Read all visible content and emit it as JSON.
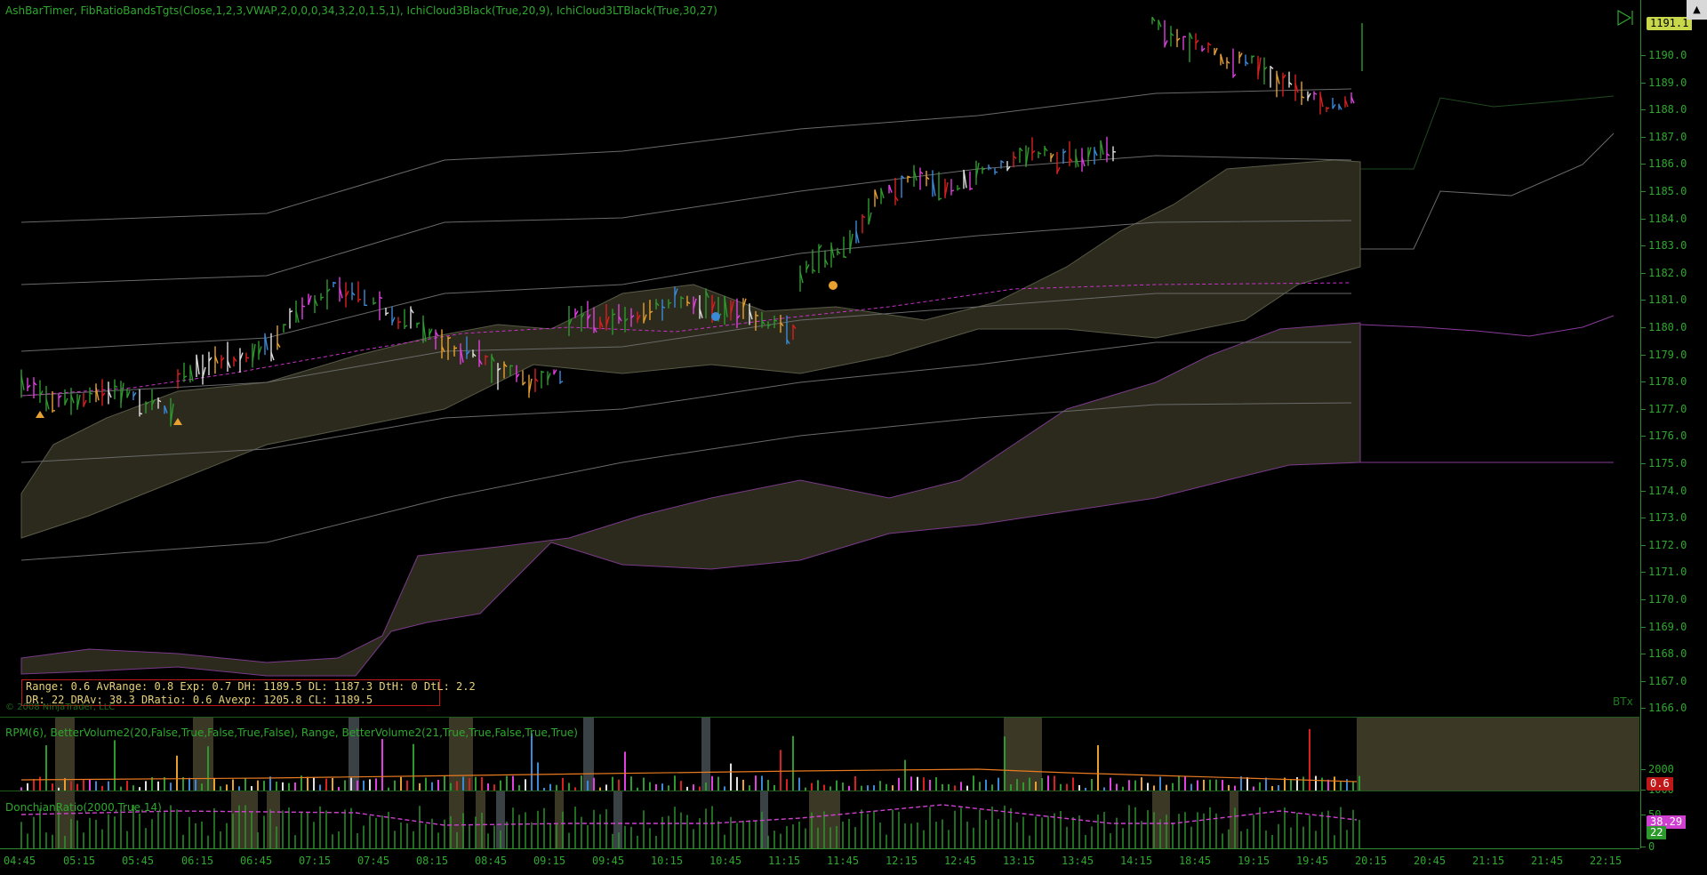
{
  "main_pane": {
    "indicators": "AshBarTimer,  FibRatioBandsTgts(Close,1,2,3,VWAP,2,0,0,0,34,3,2,0,1.5,1),  IchiCloud3Black(True,20,9),  IchiCloud3LTBlack(True,30,27)",
    "info_line1": "Range: 0.6  AvRange: 0.8  Exp: 0.7  DH: 1189.5  DL: 1187.3  DtH: 0  DtL: 2.2",
    "info_line2": "DR: 22 DRAv: 38.3 DRatio: 0.6 Avexp: 1205.8 CL: 1189.5",
    "copyright": "© 2008 NinjaTrader, LLC",
    "corner_label": "BTx",
    "last_price": "1191.1",
    "price_ticks": [
      "1190.0",
      "1189.0",
      "1188.0",
      "1187.0",
      "1186.0",
      "1185.0",
      "1184.0",
      "1183.0",
      "1182.0",
      "1181.0",
      "1180.0",
      "1179.0",
      "1178.0",
      "1177.0",
      "1176.0",
      "1175.0",
      "1174.0",
      "1173.0",
      "1172.0",
      "1171.0",
      "1170.0",
      "1169.0",
      "1168.0",
      "1167.0",
      "1166.0"
    ]
  },
  "rpm_pane": {
    "indicators": "RPM(6),  BetterVolume2(20,False,True,False,True,False),  Range,  BetterVolume2(21,True,True,False,True,True)",
    "ticks": [
      "2000",
      "1000"
    ],
    "badge": "0.6"
  },
  "donchian_pane": {
    "indicators": "DonchianRatio(2000,True,14)",
    "badge1": "38.29",
    "badge2": "22",
    "ticks": [
      "50",
      "0"
    ]
  },
  "time_axis": [
    "04:45",
    "05:15",
    "05:45",
    "06:15",
    "06:45",
    "07:15",
    "07:45",
    "08:15",
    "08:45",
    "09:15",
    "09:45",
    "10:15",
    "10:45",
    "11:15",
    "11:45",
    "12:15",
    "12:45",
    "13:15",
    "13:45",
    "14:15",
    "18:45",
    "19:15",
    "19:45",
    "20:15",
    "20:45",
    "21:15",
    "21:45",
    "22:15"
  ],
  "colors": {
    "axis": "#2ea82e",
    "band": "#6a6a6a",
    "cloud": "#2b2a1c",
    "vwap": "#c832c8",
    "up": "#2e9a2e",
    "down": "#3a8ad8",
    "accent": "#e8a030"
  }
}
